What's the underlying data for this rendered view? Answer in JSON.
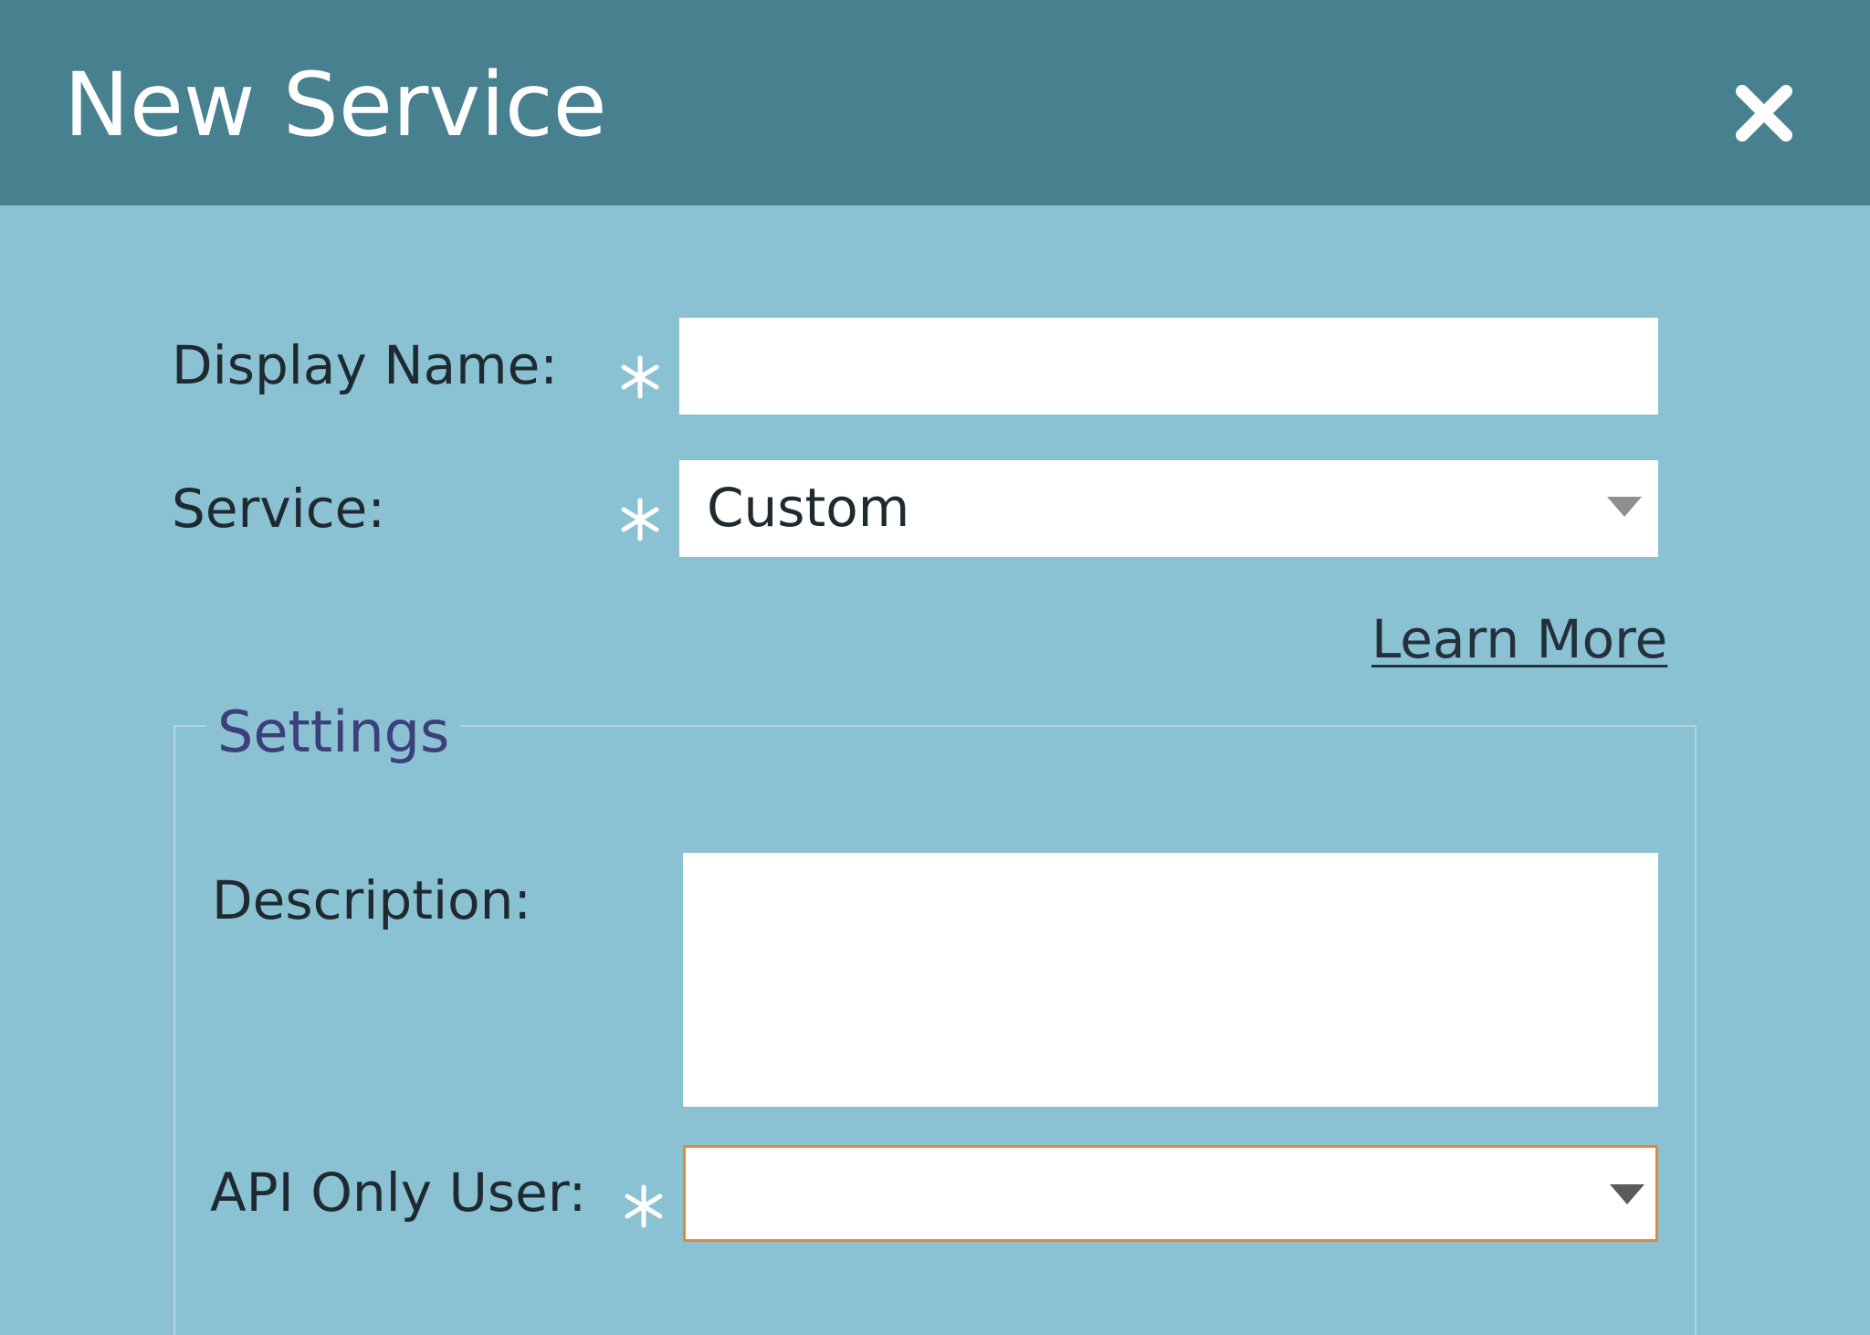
{
  "dialog": {
    "title": "New Service",
    "close_icon": "close-icon"
  },
  "form": {
    "display_name": {
      "label": "Display Name:",
      "value": "",
      "required": true
    },
    "service": {
      "label": "Service:",
      "selected": "Custom",
      "required": true
    },
    "learn_more": "Learn More"
  },
  "settings": {
    "legend": "Settings",
    "description": {
      "label": "Description:",
      "value": ""
    },
    "api_only_user": {
      "label": "API Only User:",
      "selected": "",
      "required": true
    }
  },
  "colors": {
    "header": "#47808f",
    "body": "#8ac2d4",
    "legend": "#3c3f7a",
    "focus_border": "#e0893a",
    "required_marker": "#ffffff"
  }
}
